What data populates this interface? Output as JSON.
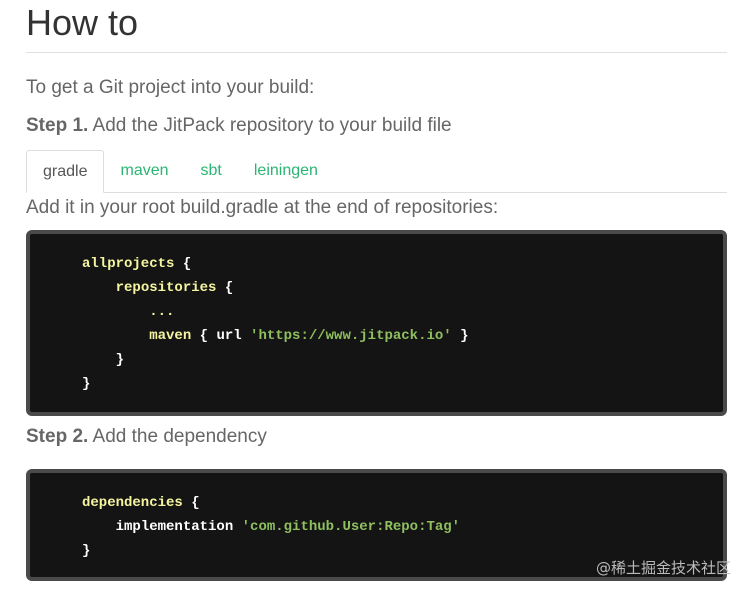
{
  "page": {
    "title": "How to",
    "intro": "To get a Git project into your build:"
  },
  "step1": {
    "label": "Step 1.",
    "text": "Add the JitPack repository to your build file"
  },
  "tabs": [
    {
      "label": "gradle",
      "active": true
    },
    {
      "label": "maven",
      "active": false
    },
    {
      "label": "sbt",
      "active": false
    },
    {
      "label": "leiningen",
      "active": false
    }
  ],
  "tab_description": "Add it in your root build.gradle at the end of repositories:",
  "code1": {
    "lines": [
      {
        "indent": 0,
        "parts": [
          {
            "t": "allprojects",
            "c": "kw"
          },
          {
            "t": " {",
            "c": ""
          }
        ]
      },
      {
        "indent": 1,
        "parts": [
          {
            "t": "repositories",
            "c": "kw"
          },
          {
            "t": " {",
            "c": ""
          }
        ]
      },
      {
        "indent": 2,
        "parts": [
          {
            "t": "...",
            "c": "kw"
          }
        ]
      },
      {
        "indent": 2,
        "parts": [
          {
            "t": "maven",
            "c": "kw"
          },
          {
            "t": " { url ",
            "c": ""
          },
          {
            "t": "'https://www.jitpack.io'",
            "c": "str"
          },
          {
            "t": " }",
            "c": ""
          }
        ]
      },
      {
        "indent": 1,
        "parts": [
          {
            "t": "}",
            "c": ""
          }
        ]
      },
      {
        "indent": 0,
        "parts": [
          {
            "t": "}",
            "c": ""
          }
        ]
      }
    ]
  },
  "step2": {
    "label": "Step 2.",
    "text": "Add the dependency"
  },
  "code2": {
    "lines": [
      {
        "indent": 0,
        "parts": [
          {
            "t": "dependencies",
            "c": "kw"
          },
          {
            "t": " {",
            "c": ""
          }
        ]
      },
      {
        "indent": 1,
        "parts": [
          {
            "t": "implementation ",
            "c": ""
          },
          {
            "t": "'com.github.User:Repo:Tag'",
            "c": "str"
          }
        ]
      },
      {
        "indent": 0,
        "parts": [
          {
            "t": "}",
            "c": ""
          }
        ]
      }
    ]
  },
  "watermark": "@稀土掘金技术社区",
  "colors": {
    "link": "#2bb573",
    "code_bg": "#141414",
    "code_border": "#4a4a4a",
    "keyword": "#f5f5a0",
    "string": "#8fbf5f"
  }
}
